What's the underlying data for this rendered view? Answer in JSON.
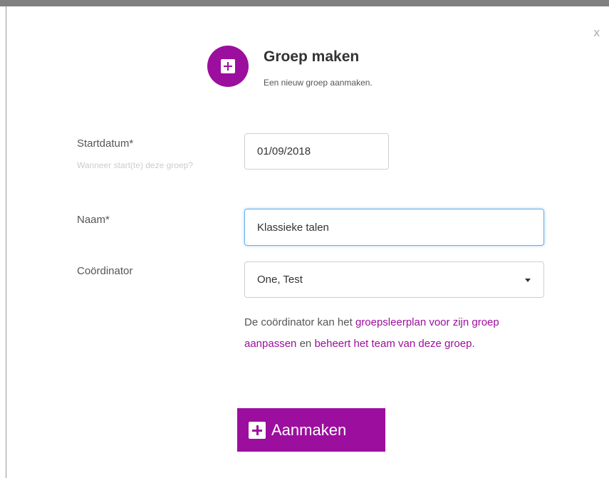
{
  "dialog": {
    "title": "Groep maken",
    "subtitle": "Een nieuw groep aanmaken.",
    "close_label": "x"
  },
  "icons": {
    "header": "plus-square-icon",
    "calendar": "calendar-icon",
    "caret": "chevron-down-icon",
    "button": "plus-square-icon"
  },
  "colors": {
    "accent": "#9c0e9e",
    "focus_border": "#66afe9"
  },
  "form": {
    "start": {
      "label": "Startdatum*",
      "hint": "Wanneer start(te) deze groep?",
      "value": "01/09/2018"
    },
    "name": {
      "label": "Naam*",
      "value": "Klassieke talen"
    },
    "coordinator": {
      "label": "Coördinator",
      "value": "One, Test"
    }
  },
  "help": {
    "t1": "De coördinator kan het ",
    "l1": "groepsleerplan voor zijn groep aanpassen",
    "t2": " en ",
    "l2": "beheert het team van deze groep",
    "t3": "."
  },
  "submit": {
    "label": "Aanmaken"
  }
}
